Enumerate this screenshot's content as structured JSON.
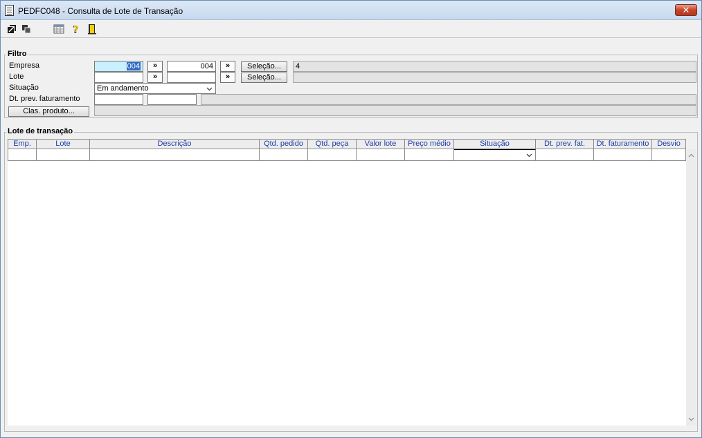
{
  "window": {
    "title": "PEDFC048 - Consulta de Lote de Transação",
    "close_label": "✕"
  },
  "toolbar": {
    "buttons": [
      {
        "name": "export-icon"
      },
      {
        "name": "copy-icon"
      },
      {
        "name": "table-icon"
      },
      {
        "name": "help-icon"
      },
      {
        "name": "exit-door-icon"
      }
    ]
  },
  "filtro": {
    "legend": "Filtro",
    "empresa": {
      "label": "Empresa",
      "from": "004",
      "to": "004",
      "arrow1": "»",
      "arrow2": "»",
      "selection_button": "Seleção...",
      "selection_value": "4"
    },
    "lote": {
      "label": "Lote",
      "from": "",
      "to": "",
      "arrow1": "»",
      "arrow2": "»",
      "selection_button": "Seleção...",
      "selection_value": ""
    },
    "situacao": {
      "label": "Situação",
      "value": "Em andamento"
    },
    "dt_prev": {
      "label": "Dt. prev. faturamento",
      "from": "",
      "to": ""
    },
    "clas_produto": {
      "button": "Clas. produto...",
      "value": ""
    }
  },
  "lote_transacao": {
    "legend": "Lote de transação",
    "columns": [
      "Emp.",
      "Lote",
      "Descrição",
      "Qtd. pedido",
      "Qtd. peça",
      "Valor lote",
      "Preço médio",
      "Situação",
      "Dt. prev. fat.",
      "Dt. faturamento",
      "Desvio"
    ],
    "rows": []
  }
}
